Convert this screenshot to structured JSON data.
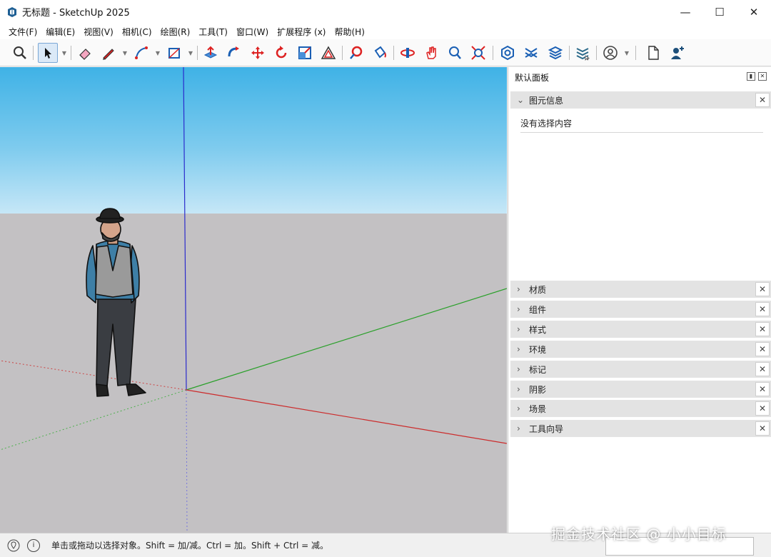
{
  "window": {
    "title": "无标题 - SketchUp 2025",
    "minimize": "—",
    "maximize": "☐",
    "close": "✕"
  },
  "menu": [
    "文件(F)",
    "编辑(E)",
    "视图(V)",
    "相机(C)",
    "绘图(R)",
    "工具(T)",
    "窗口(W)",
    "扩展程序 (x)",
    "帮助(H)"
  ],
  "toolbar": {
    "tools": [
      {
        "name": "zoom-icon"
      },
      {
        "name": "select-arrow-icon",
        "active": true
      },
      {
        "name": "eraser-icon"
      },
      {
        "name": "pencil-line-icon"
      },
      {
        "name": "arc-icon"
      },
      {
        "name": "rectangle-icon"
      },
      {
        "name": "push-pull-icon"
      },
      {
        "name": "follow-me-icon"
      },
      {
        "name": "move-icon"
      },
      {
        "name": "rotate-icon"
      },
      {
        "name": "scale-icon"
      },
      {
        "name": "offset-icon"
      },
      {
        "name": "tape-measure-icon"
      },
      {
        "name": "paint-bucket-icon"
      },
      {
        "name": "orbit-icon"
      },
      {
        "name": "pan-icon"
      },
      {
        "name": "zoom-window-icon"
      },
      {
        "name": "zoom-extents-icon"
      },
      {
        "name": "3d-warehouse-icon"
      },
      {
        "name": "extension-warehouse-icon"
      },
      {
        "name": "layout-send-icon"
      },
      {
        "name": "extension-manager-icon"
      },
      {
        "name": "account-icon"
      },
      {
        "name": "new-file-icon"
      },
      {
        "name": "add-user-icon"
      }
    ]
  },
  "tray": {
    "title": "默认面板",
    "pin": "▮",
    "close": "✕",
    "entity_info": {
      "label": "图元信息",
      "content": "没有选择内容",
      "expanded": true
    },
    "panels": [
      "材质",
      "组件",
      "样式",
      "环境",
      "标记",
      "阴影",
      "场景",
      "工具向导"
    ],
    "panel_close": "✕",
    "chevron_right": "›",
    "chevron_down": "⌄"
  },
  "status": {
    "info_icon": "i",
    "message": "单击或拖动以选择对象。Shift = 加/减。Ctrl = 加。Shift + Ctrl = 减。"
  },
  "watermark": "掘金技术社区 @ 小小目标",
  "colors": {
    "x_axis": "#cc2b2b",
    "y_axis": "#2aa02a",
    "z_axis": "#2b2bcc",
    "sky_top": "#3fb2e6",
    "ground": "#c3c1c3"
  }
}
